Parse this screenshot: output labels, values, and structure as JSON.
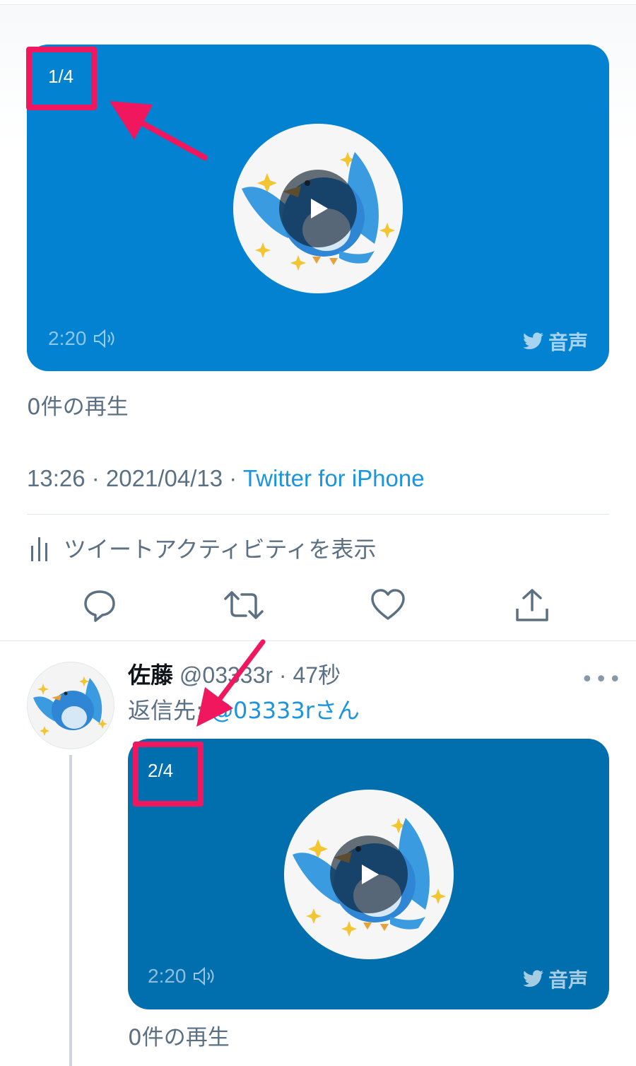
{
  "tweet_main": {
    "media": {
      "counter": "1/4",
      "duration": "2:20",
      "brand_label": "音声",
      "volume_icon": "speaker-icon",
      "play_icon": "play-icon",
      "bird_icon": "twitter-bird-icon"
    },
    "views": "0件の再生",
    "timestamp": "13:26 · 2021/04/13 · ",
    "source": "Twitter for iPhone",
    "activity_label": "ツイートアクティビティを表示",
    "actions": {
      "reply_icon": "reply-icon",
      "retweet_icon": "retweet-icon",
      "like_icon": "heart-icon",
      "share_icon": "share-icon"
    }
  },
  "reply_tweet": {
    "display_name": "佐藤",
    "handle_time": "@03333r · 47秒",
    "reply_prefix": "返信先: ",
    "reply_to": "@03333rさん",
    "more_label": "•••",
    "media": {
      "counter": "2/4",
      "duration": "2:20",
      "brand_label": "音声"
    },
    "views": "0件の再生"
  },
  "colors": {
    "media_blue": "#0282d1",
    "media_blue_dark": "#016eae",
    "highlight": "#f0175f",
    "link": "#1b95e0",
    "secondary_text": "#5b7083"
  }
}
